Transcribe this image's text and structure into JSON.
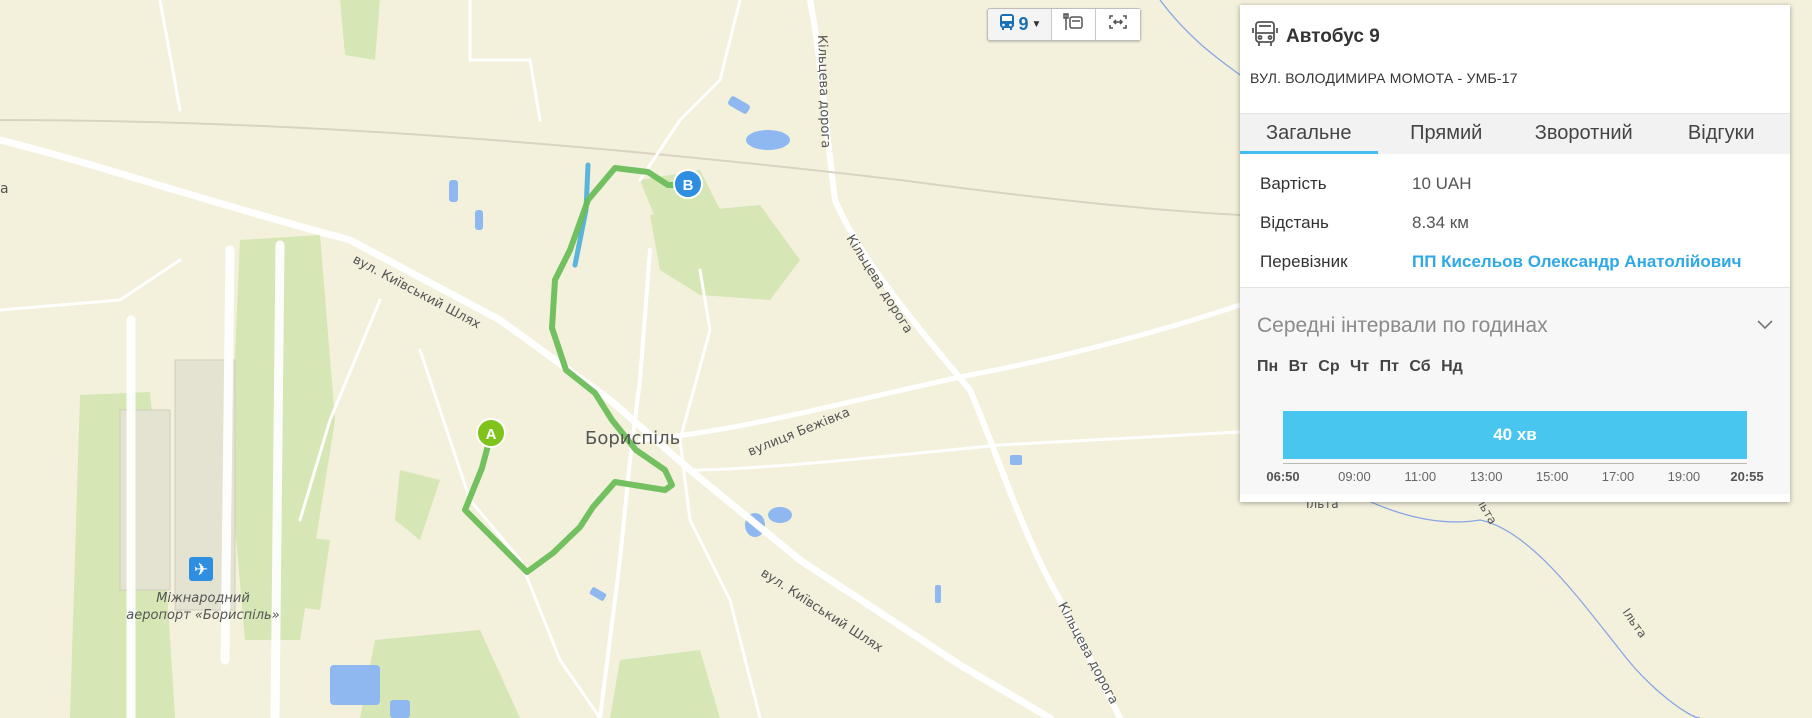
{
  "map": {
    "labels": {
      "city": "Бориспіль",
      "street_kyiv_1": "вул. Київський Шлях",
      "street_kyiv_2": "вул. Київський Шлях",
      "street_bezhivka": "вулиця Бежівка",
      "ring_road_1": "Кільцева дорога",
      "ring_road_2": "Кільцева дорога",
      "ring_road_3": "Кільцева дорога",
      "airport_1": "Міжнародний",
      "airport_2": "аеропорт «Бориспіль»",
      "river_1": "Ільта",
      "river_2": "Ільта",
      "river_3": "Ільта",
      "edge_fragment": "а"
    },
    "markers": {
      "start": "A",
      "end": "B"
    },
    "route_color": "#6cbd5a",
    "reverse_color": "#4aa9d6"
  },
  "toolbar": {
    "route_number": "9",
    "icons": [
      "bus-icon",
      "bus-stop-icon",
      "fit-bounds-icon"
    ]
  },
  "panel": {
    "title": "Автобус 9",
    "subtitle": "ВУЛ. ВОЛОДИМИРА МОМОТА - УМБ-17",
    "tabs": [
      "Загальне",
      "Прямий",
      "Зворотний",
      "Відгуки"
    ],
    "active_tab": "Загальне",
    "props": {
      "cost_label": "Вартість",
      "cost_value": "10 UAH",
      "distance_label": "Відстань",
      "distance_value": "8.34 км",
      "carrier_label": "Перевізник",
      "carrier_value": "ПП Кисельов Олександр Анатолійович"
    },
    "intervals": {
      "title": "Середні інтервали по годинах",
      "days": [
        "Пн",
        "Вт",
        "Ср",
        "Чт",
        "Пт",
        "Сб",
        "Нд"
      ],
      "bar_label": "40 хв",
      "start_time": "06:50",
      "end_time": "20:55",
      "ticks": [
        "09:00",
        "11:00",
        "13:00",
        "15:00",
        "17:00",
        "19:00"
      ]
    },
    "accent_color": "#48c6f0",
    "link_color": "#2fa9e6"
  }
}
